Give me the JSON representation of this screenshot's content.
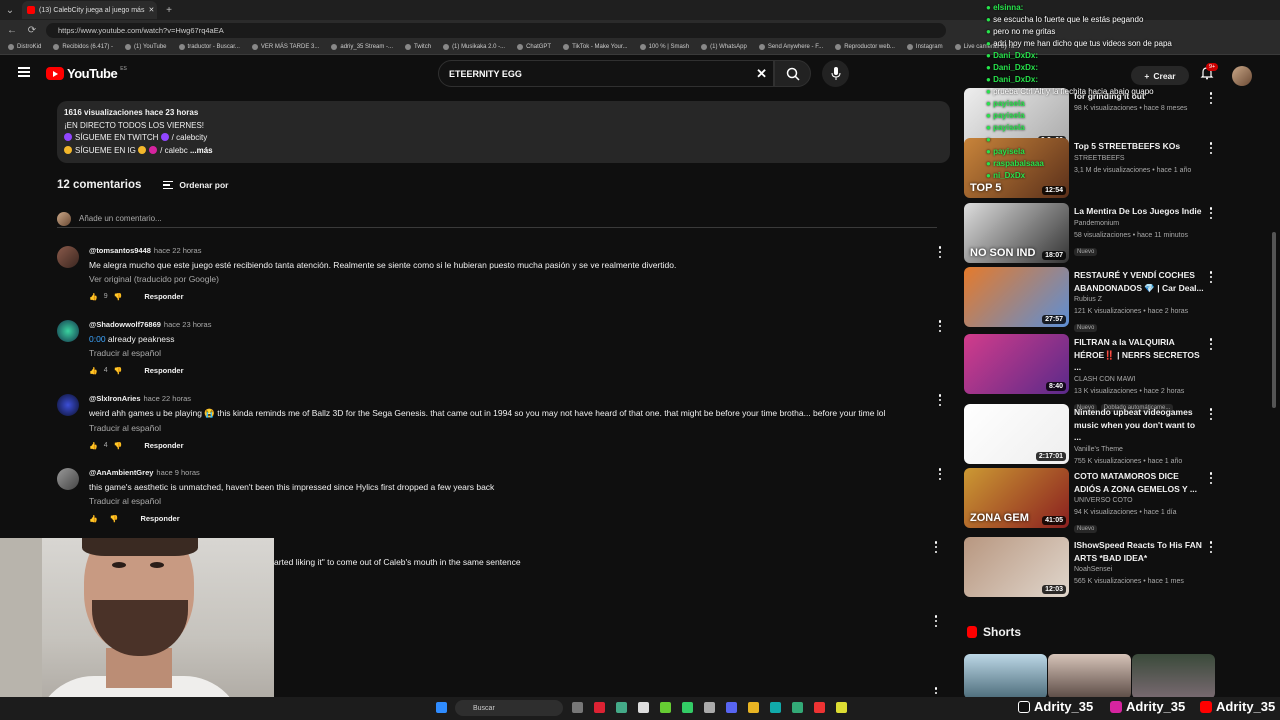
{
  "browser": {
    "tab_title": "(13) CalebCity juega al juego más",
    "url": "https://www.youtube.com/watch?v=Hwg67rq4aEA",
    "bookmarks": [
      "DistroKid",
      "Recibidos (6.417) -",
      "(1) YouTube",
      "traductor - Buscar...",
      "VER MÁS TARDE 3...",
      "adriy_35 Stream -...",
      "Twitch",
      "(1) Musikaka 2.0 -...",
      "ChatGPT",
      "TikTok - Make Your...",
      "100 % | Smash",
      "(1) WhatsApp",
      "Send Anywhere - F...",
      "Reproductor web...",
      "Instagram",
      "Live cameras by ra..."
    ]
  },
  "header": {
    "logo_text": "YouTube",
    "logo_region": "ES",
    "search_query": "ETEERNITY EGG",
    "create_label": "Crear",
    "notif_count": "9+"
  },
  "description": {
    "meta": "1616 visualizaciones  hace 23 horas",
    "line1": "¡EN DIRECTO TODOS LOS VIERNES!",
    "line2": "SÍGUEME EN TWITCH",
    "line2_handle": "/ calebcity",
    "line3": "SÍGUEME EN IG",
    "line3_handle": "/ calebc",
    "more": "...más"
  },
  "comments_header": {
    "count": "12 comentarios",
    "sort": "Ordenar por",
    "add_placeholder": "Añade un comentario..."
  },
  "comments": [
    {
      "author": "@tomsantos9448",
      "time": "hace 22 horas",
      "text": "Me alegra mucho que este juego esté recibiendo tanta atención. Realmente se siente como si le hubieran puesto mucha pasión y se ve realmente divertido.",
      "translate": "Ver original (traducido por Google)",
      "likes": "9",
      "reply": "Responder"
    },
    {
      "author": "@Shadowwolf76869",
      "time": "hace 23 horas",
      "timestamp": "0:00",
      "text": " already peakness",
      "translate": "Traducir al español",
      "likes": "4",
      "reply": "Responder"
    },
    {
      "author": "@SlxIronAries",
      "time": "hace 22 horas",
      "text": "weird ahh games u be playing 😭 this kinda reminds me of Ballz 3D for the Sega Genesis. that came out in 1994 so you may not have heard of that one. that might be before your time brotha... before your time lol",
      "translate": "Traducir al español",
      "likes": "4",
      "reply": "Responder"
    },
    {
      "author": "@AnAmbientGrey",
      "time": "hace 9 horas",
      "text": "this game's aesthetic is unmatched, haven't been this impressed since Hylics first dropped a few years back",
      "translate": "Traducir al español",
      "likes": "",
      "reply": "Responder"
    }
  ],
  "partial_comment": "arted liking it\" to come out of Caleb's mouth in the same sentence",
  "sidebar": [
    {
      "title": "for grinding it out",
      "channel": "",
      "meta": "98 K visualizaciones • hace 8 meses",
      "duration": "2:2 :06",
      "badge": ""
    },
    {
      "title": "Top 5 STREETBEEFS KOs",
      "channel": "STREETBEEFS",
      "meta": "3,1 M de visualizaciones • hace 1 año",
      "duration": "12:54",
      "badge": "",
      "thumb_text": "TOP 5"
    },
    {
      "title": "La Mentira De Los Juegos Indie",
      "channel": "Pandemonium",
      "meta": "58 visualizaciones • hace 11 minutos",
      "duration": "18:07",
      "badge": "Nuevo",
      "thumb_text": "NO SON IND"
    },
    {
      "title": "RESTAURÉ Y VENDÍ COCHES ABANDONADOS 💎 | Car Deal...",
      "channel": "Rubius Z",
      "meta": "121 K visualizaciones • hace 2 horas",
      "duration": "27:57",
      "badge": "Nuevo"
    },
    {
      "title": "FILTRAN a la VALQUIRIA HÉROE‼️ | NERFS SECRETOS ...",
      "channel": "CLASH CON MAWI",
      "meta": "13 K visualizaciones • hace 2 horas",
      "duration": "8:40",
      "badge": "Nuevo",
      "badge2": "Doblado automáticame..."
    },
    {
      "title": "Nintendo upbeat videogames music when you don't want to ...",
      "channel": "Vanille's Theme",
      "meta": "755 K visualizaciones • hace 1 año",
      "duration": "2:17:01",
      "badge": ""
    },
    {
      "title": "COTO MATAMOROS DICE ADIÓS A ZONA GEMELOS Y ...",
      "channel": "UNIVERSO COTO",
      "meta": "94 K visualizaciones • hace 1 día",
      "duration": "41:05",
      "badge": "Nuevo",
      "thumb_text": "ZONA GEM"
    },
    {
      "title": "IShowSpeed Reacts To His FAN ARTS *BAD IDEA*",
      "channel": "NoahSensei",
      "meta": "565 K visualizaciones • hace 1 mes",
      "duration": "12:03",
      "badge": ""
    }
  ],
  "shorts_label": "Shorts",
  "chat": [
    {
      "user": "elsinna:",
      "msg": ""
    },
    {
      "user": "",
      "msg": "se escucha lo fuerte que le estás pegando"
    },
    {
      "user": "",
      "msg": "pero no me gritas"
    },
    {
      "user": "",
      "msg": "adri hoy me han dicho que tus videos son de papa"
    },
    {
      "user": "Dani_DxDx:",
      "msg": ""
    },
    {
      "user": "Dani_DxDx:",
      "msg": ""
    },
    {
      "user": "Dani_DxDx:",
      "msg": ""
    },
    {
      "user": "",
      "msg": "prueba Ctrl Alt y la flechita hacia abajo guapo"
    },
    {
      "user": "payisela",
      "msg": ""
    },
    {
      "user": "payisela",
      "msg": ""
    },
    {
      "user": "payisela",
      "msg": ""
    },
    {
      "user": "",
      "msg": ""
    },
    {
      "user": "payisela",
      "msg": ""
    },
    {
      "user": "raspabalsaaa",
      "msg": ""
    },
    {
      "user": "ni_DxDx",
      "msg": ""
    }
  ],
  "taskbar": {
    "search": "Buscar",
    "socials": [
      "Adrity_35",
      "Adrity_35",
      "Adrity_35"
    ]
  },
  "colors": {
    "brand": "#ff0000",
    "bg": "#0f0f0f",
    "chat_user": "#27e34b"
  }
}
